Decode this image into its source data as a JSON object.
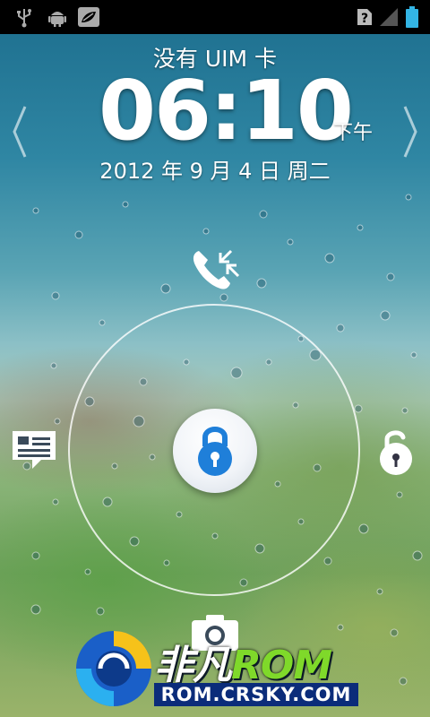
{
  "status_bar": {
    "left_icons": [
      "usb-icon",
      "android-debug-icon",
      "leaf-icon"
    ],
    "right_icons": [
      "no-sim-icon",
      "signal-icon",
      "battery-icon"
    ]
  },
  "lockscreen": {
    "operator": "没有 UIM 卡",
    "time": "06:10",
    "ampm": "下午",
    "date": "2012 年 9 月 4 日 周二",
    "targets": {
      "top": "phone-icon",
      "left": "message-icon",
      "right": "unlock-icon",
      "bottom": "camera-icon",
      "center": "lock-icon"
    }
  },
  "watermark": {
    "title_cn": "非凡",
    "title_en": "ROM",
    "url": "ROM.CRSKY.COM"
  },
  "colors": {
    "accent_blue": "#1f7fd9",
    "watermark_green": "#7fd92a",
    "watermark_url_bg": "#0b2c7a"
  }
}
